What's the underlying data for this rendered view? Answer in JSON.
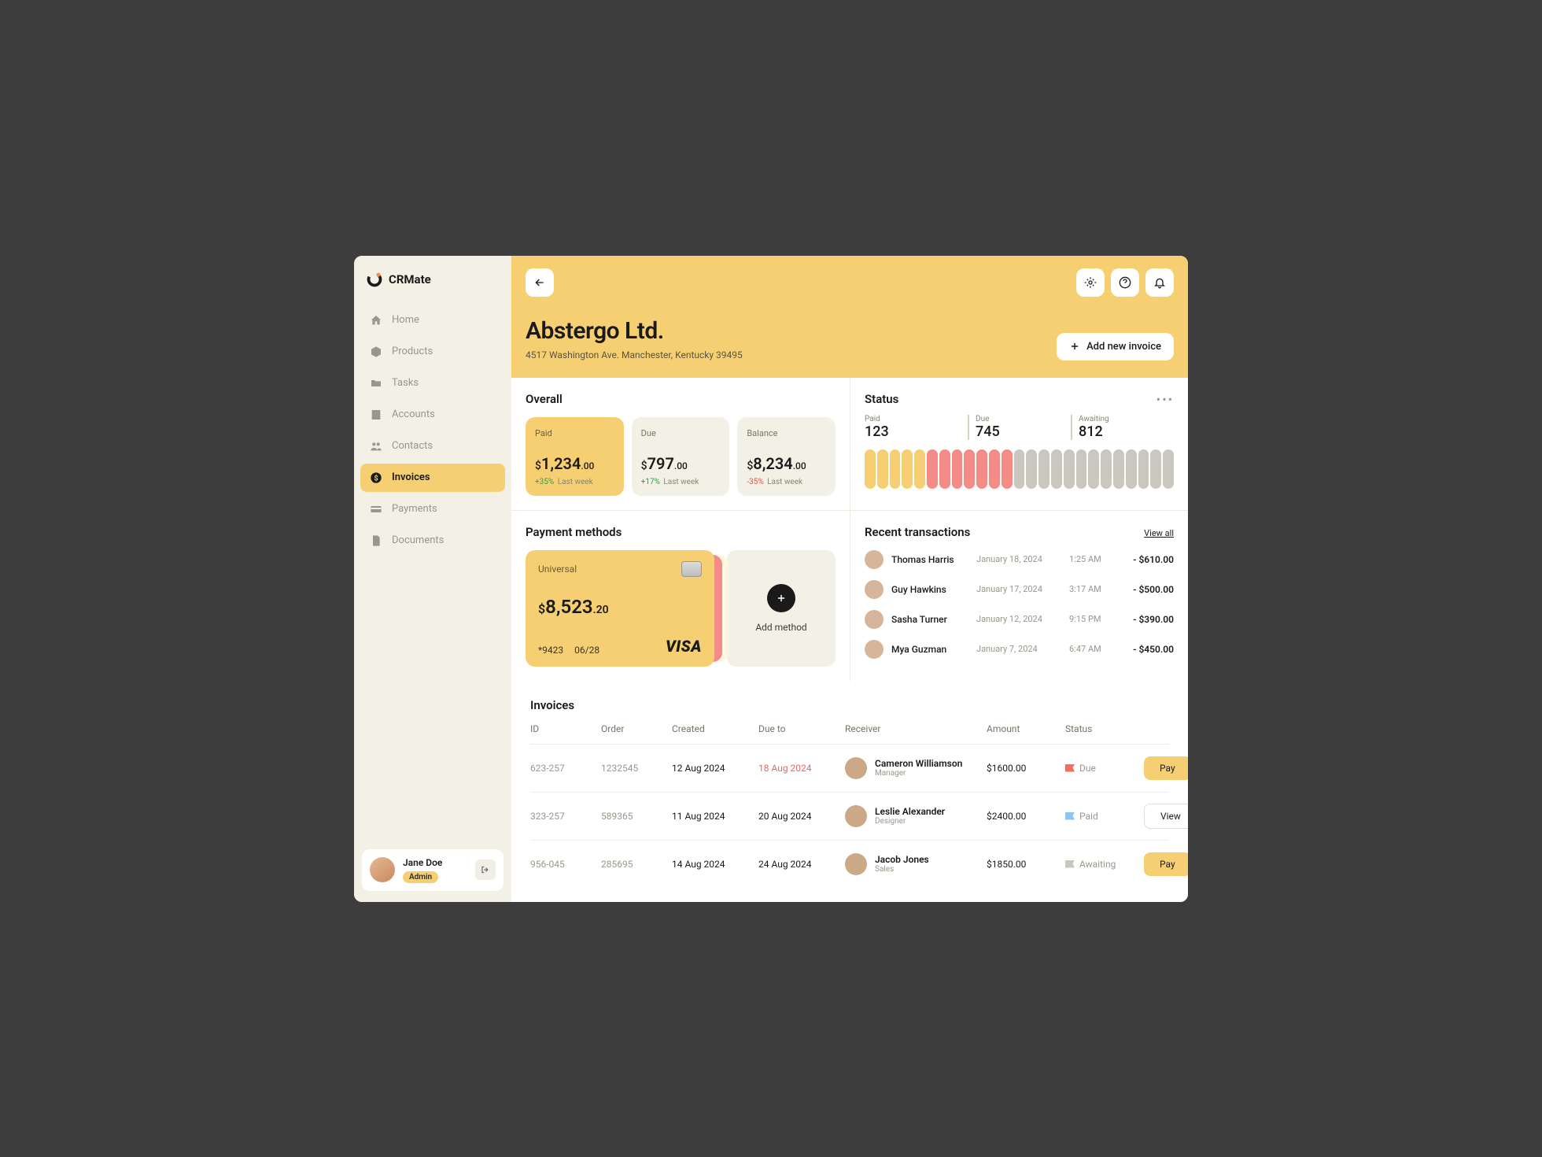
{
  "brand": "CRMate",
  "sidebar": {
    "items": [
      {
        "label": "Home"
      },
      {
        "label": "Products"
      },
      {
        "label": "Tasks"
      },
      {
        "label": "Accounts"
      },
      {
        "label": "Contacts"
      },
      {
        "label": "Invoices"
      },
      {
        "label": "Payments"
      },
      {
        "label": "Documents"
      }
    ]
  },
  "profile": {
    "name": "Jane Doe",
    "role": "Admin"
  },
  "header": {
    "title": "Abstergo Ltd.",
    "address": "4517 Washington Ave. Manchester, Kentucky 39495",
    "add_invoice_label": "Add new invoice"
  },
  "overall": {
    "title": "Overall",
    "cards": [
      {
        "label": "Paid",
        "currency": "$",
        "int": "1,234",
        "cents": ".00",
        "delta": "+35%",
        "delta_sub": "Last week",
        "tone": "up"
      },
      {
        "label": "Due",
        "currency": "$",
        "int": "797",
        "cents": ".00",
        "delta": "+17%",
        "delta_sub": "Last week",
        "tone": "up"
      },
      {
        "label": "Balance",
        "currency": "$",
        "int": "8,234",
        "cents": ".00",
        "delta": "-35%",
        "delta_sub": "Last week",
        "tone": "down"
      }
    ]
  },
  "status": {
    "title": "Status",
    "stats": [
      {
        "label": "Paid",
        "value": "123"
      },
      {
        "label": "Due",
        "value": "745"
      },
      {
        "label": "Awaiting",
        "value": "812"
      }
    ],
    "pills": [
      "paid",
      "paid",
      "paid",
      "paid",
      "paid",
      "due",
      "due",
      "due",
      "due",
      "due",
      "due",
      "due",
      "await",
      "await",
      "await",
      "await",
      "await",
      "await",
      "await",
      "await",
      "await",
      "await",
      "await",
      "await",
      "await"
    ]
  },
  "payment_methods": {
    "title": "Payment methods",
    "card": {
      "name": "Universal",
      "currency": "$",
      "int": "8,523",
      "cents": ".20",
      "mask": "*9423",
      "exp": "06/28",
      "brand": "VISA"
    },
    "add_label": "Add method"
  },
  "recent": {
    "title": "Recent transactions",
    "view_all": "View all",
    "txs": [
      {
        "name": "Thomas Harris",
        "date": "January 18, 2024",
        "time": "1:25 AM",
        "amount": "- $610.00"
      },
      {
        "name": "Guy Hawkins",
        "date": "January 17, 2024",
        "time": "3:17 AM",
        "amount": "- $500.00"
      },
      {
        "name": "Sasha Turner",
        "date": "January 12, 2024",
        "time": "9:15 PM",
        "amount": "- $390.00"
      },
      {
        "name": "Mya Guzman",
        "date": "January 7, 2024",
        "time": "6:47 AM",
        "amount": "- $450.00"
      }
    ]
  },
  "invoices": {
    "title": "Invoices",
    "columns": {
      "id": "ID",
      "order": "Order",
      "created": "Created",
      "due": "Due to",
      "receiver": "Receiver",
      "amount": "Amount",
      "status": "Status"
    },
    "rows": [
      {
        "id": "623-257",
        "order": "1232545",
        "created": "12 Aug 2024",
        "due": "18 Aug 2024",
        "due_tone": "red",
        "receiver": "Cameron Williamson",
        "role": "Manager",
        "amount": "$1600.00",
        "status": "Due",
        "flag": "red",
        "action": "Pay",
        "action_primary": true
      },
      {
        "id": "323-257",
        "order": "589365",
        "created": "11 Aug 2024",
        "due": "20 Aug 2024",
        "due_tone": "",
        "receiver": "Leslie Alexander",
        "role": "Designer",
        "amount": "$2400.00",
        "status": "Paid",
        "flag": "blue",
        "action": "View",
        "action_primary": false
      },
      {
        "id": "956-045",
        "order": "285695",
        "created": "14 Aug 2024",
        "due": "24 Aug 2024",
        "due_tone": "",
        "receiver": "Jacob Jones",
        "role": "Sales",
        "amount": "$1850.00",
        "status": "Awaiting",
        "flag": "gray",
        "action": "Pay",
        "action_primary": true
      }
    ]
  }
}
